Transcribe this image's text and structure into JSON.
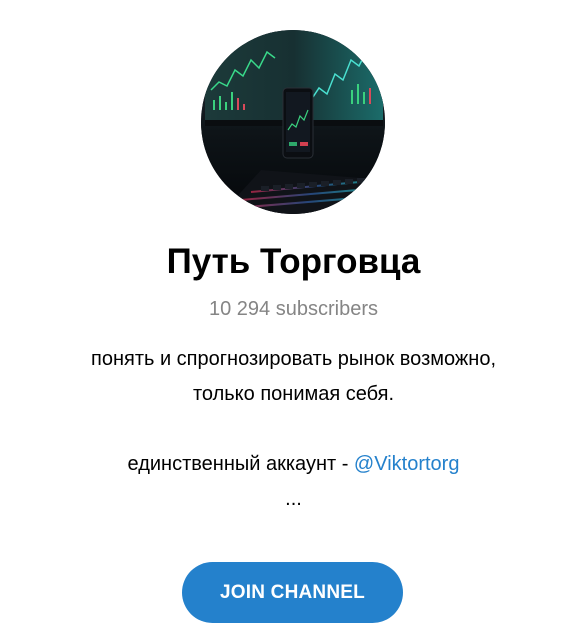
{
  "channel": {
    "title": "Путь Торговца",
    "subscribers": "10 294 subscribers",
    "description_line1": "понять и спрогнозировать рынок возможно,",
    "description_line2": "только понимая себя.",
    "account_prefix": "единственный аккаунт - ",
    "account_link": "@Viktortorg",
    "ellipsis": "...",
    "avatar_icon": "trading-desk-photo"
  },
  "actions": {
    "join_label": "JOIN CHANNEL"
  },
  "colors": {
    "accent": "#2481cc",
    "muted_text": "#858585"
  }
}
